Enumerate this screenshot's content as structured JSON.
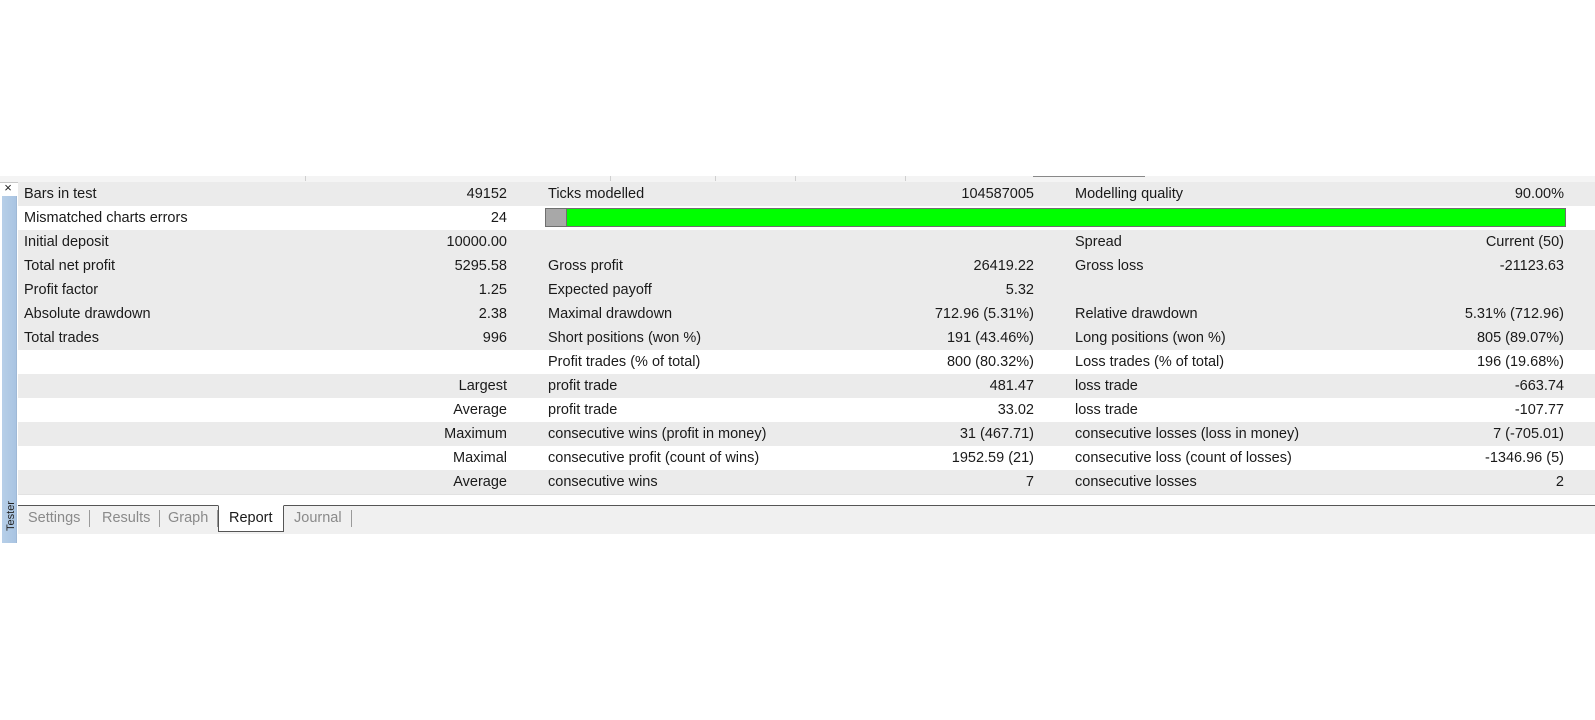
{
  "window": {
    "close_glyph": "×",
    "side_label": "Tester"
  },
  "report": {
    "rows": [
      {
        "c1": "Bars in test",
        "v1": "49152",
        "c2": "Ticks modelled",
        "v2": "104587005",
        "c3": "Modelling quality",
        "v3": "90.00%"
      },
      {
        "c1": "Mismatched charts errors",
        "v1": "24"
      },
      {
        "c1": "Initial deposit",
        "v1": "10000.00",
        "c3": "Spread",
        "v3": "Current (50)"
      },
      {
        "c1": "Total net profit",
        "v1": "5295.58",
        "c2": "Gross profit",
        "v2": "26419.22",
        "c3": "Gross loss",
        "v3": "-21123.63"
      },
      {
        "c1": "Profit factor",
        "v1": "1.25",
        "c2": "Expected payoff",
        "v2": "5.32"
      },
      {
        "c1": "Absolute drawdown",
        "v1": "2.38",
        "c2": "Maximal drawdown",
        "v2": "712.96 (5.31%)",
        "c3": "Relative drawdown",
        "v3": "5.31% (712.96)"
      },
      {
        "c1": "Total trades",
        "v1": "996",
        "c2": "Short positions (won %)",
        "v2": "191 (43.46%)",
        "c3": "Long positions (won %)",
        "v3": "805 (89.07%)"
      },
      {
        "c2": "Profit trades (% of total)",
        "v2": "800 (80.32%)",
        "c3": "Loss trades (% of total)",
        "v3": "196 (19.68%)"
      },
      {
        "l1": "Largest",
        "c2": "profit trade",
        "v2": "481.47",
        "c3": "loss trade",
        "v3": "-663.74"
      },
      {
        "l1": "Average",
        "c2": "profit trade",
        "v2": "33.02",
        "c3": "loss trade",
        "v3": "-107.77"
      },
      {
        "l1": "Maximum",
        "c2": "consecutive wins (profit in money)",
        "v2": "31 (467.71)",
        "c3": "consecutive losses (loss in money)",
        "v3": "7 (-705.01)"
      },
      {
        "l1": "Maximal",
        "c2": "consecutive profit (count of wins)",
        "v2": "1952.59 (21)",
        "c3": "consecutive loss (count of losses)",
        "v3": "-1346.96 (5)"
      },
      {
        "l1": "Average",
        "c2": "consecutive wins",
        "v2": "7",
        "c3": "consecutive losses",
        "v3": "2"
      }
    ],
    "modelling_quality_fraction": 0.9,
    "quality_bar_colors": {
      "good": "#00ff00",
      "missing": "#a8a8a8"
    }
  },
  "tabs": [
    {
      "label": "Settings",
      "active": false
    },
    {
      "label": "Results",
      "active": false
    },
    {
      "label": "Graph",
      "active": false
    },
    {
      "label": "Report",
      "active": true
    },
    {
      "label": "Journal",
      "active": false
    }
  ]
}
